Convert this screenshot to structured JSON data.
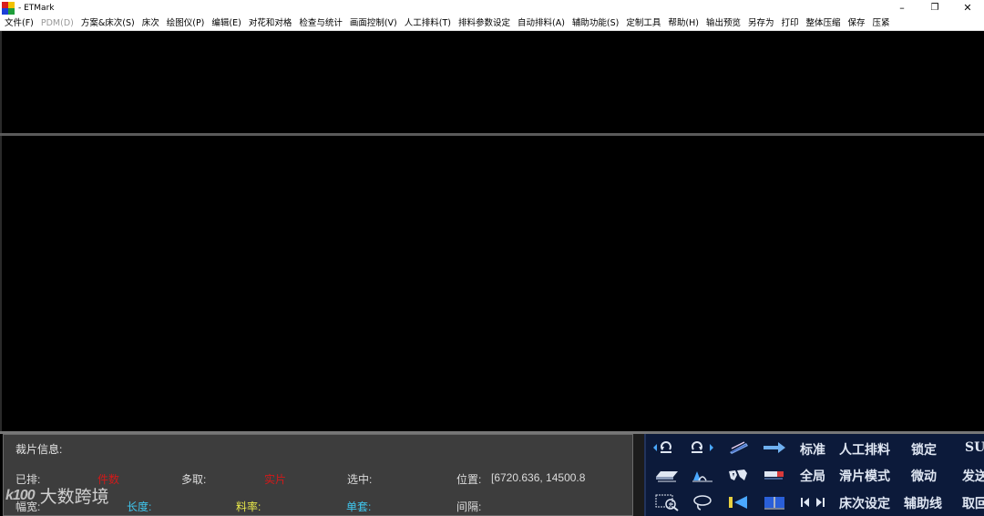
{
  "window": {
    "title": "- ETMark",
    "minimize": "–",
    "restore": "❐",
    "close": "✕"
  },
  "menu": [
    {
      "label": "文件(F)",
      "enabled": true
    },
    {
      "label": "PDM(D)",
      "enabled": false
    },
    {
      "label": "方案&床次(S)",
      "enabled": true
    },
    {
      "label": "床次",
      "enabled": true
    },
    {
      "label": "绘图仪(P)",
      "enabled": true
    },
    {
      "label": "编辑(E)",
      "enabled": true
    },
    {
      "label": "对花和对格",
      "enabled": true
    },
    {
      "label": "检查与统计",
      "enabled": true
    },
    {
      "label": "画面控制(V)",
      "enabled": true
    },
    {
      "label": "人工排料(T)",
      "enabled": true
    },
    {
      "label": "排料参数设定",
      "enabled": true
    },
    {
      "label": "自动排料(A)",
      "enabled": true
    },
    {
      "label": "辅助功能(S)",
      "enabled": true
    },
    {
      "label": "定制工具",
      "enabled": true
    },
    {
      "label": "帮助(H)",
      "enabled": true
    },
    {
      "label": "输出预览",
      "enabled": true
    },
    {
      "label": "另存为",
      "enabled": true
    },
    {
      "label": "打印",
      "enabled": true
    },
    {
      "label": "整体压缩",
      "enabled": true
    },
    {
      "label": "保存",
      "enabled": true
    },
    {
      "label": "压紧",
      "enabled": true
    }
  ],
  "info": {
    "title": "裁片信息:",
    "placed_label": "已排:",
    "placed_value": "件数",
    "extra_label": "多取:",
    "extra_value": "实片",
    "selected_label": "选中:",
    "position_label": "位置:",
    "position_value": "[6720.636, 14500.8",
    "width_label": "幅宽:",
    "length_label": "长度:",
    "rate_label": "料率:",
    "sets_label": "单套:",
    "gap_label": "间隔:"
  },
  "colors": {
    "red_value": "#d11a1a",
    "cyan_label": "#3fc8f0",
    "yellow_label": "#e8e84a",
    "white_label": "#dcdcdc"
  },
  "tools": {
    "standard": "标准",
    "manual": "人工排料",
    "lock": "锁定",
    "su": "SU",
    "global": "全局",
    "slide": "滑片模式",
    "fine": "微动",
    "send": "发送",
    "bed": "床次设定",
    "guide": "辅助线",
    "take": "取回"
  },
  "watermark": {
    "logo": "k100",
    "text": "大数跨境"
  }
}
